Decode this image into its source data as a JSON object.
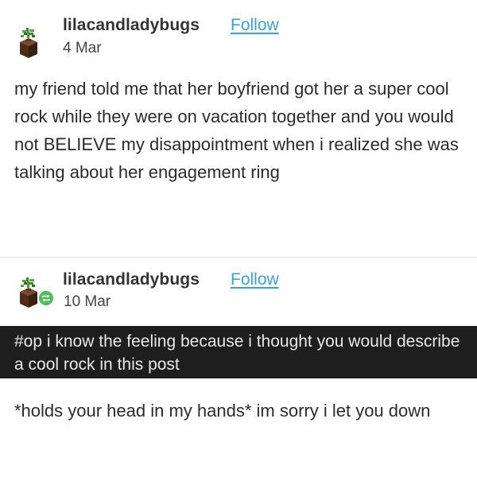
{
  "post1": {
    "username": "lilacandladybugs",
    "follow_label": "Follow",
    "date": "4 Mar",
    "avatar_icon": "plant-pot-icon",
    "body": "my friend told me that her boyfriend got her a super cool rock while they were on vacation together and you would not BELIEVE my disappointment when i realized she was talking about her engagement ring"
  },
  "post2": {
    "username": "lilacandladybugs",
    "follow_label": "Follow",
    "date": "10 Mar",
    "avatar_icon": "plant-pot-icon",
    "badge_icon": "reblog-icon",
    "tags": "#op i know the feeling because i thought you would describe a cool rock in this post",
    "body": "*holds your head in my hands* im sorry i let you down"
  },
  "colors": {
    "follow": "#3aa1d6",
    "tag_bar_bg": "#1e1e1e",
    "reblog_badge": "#4fbf58"
  }
}
